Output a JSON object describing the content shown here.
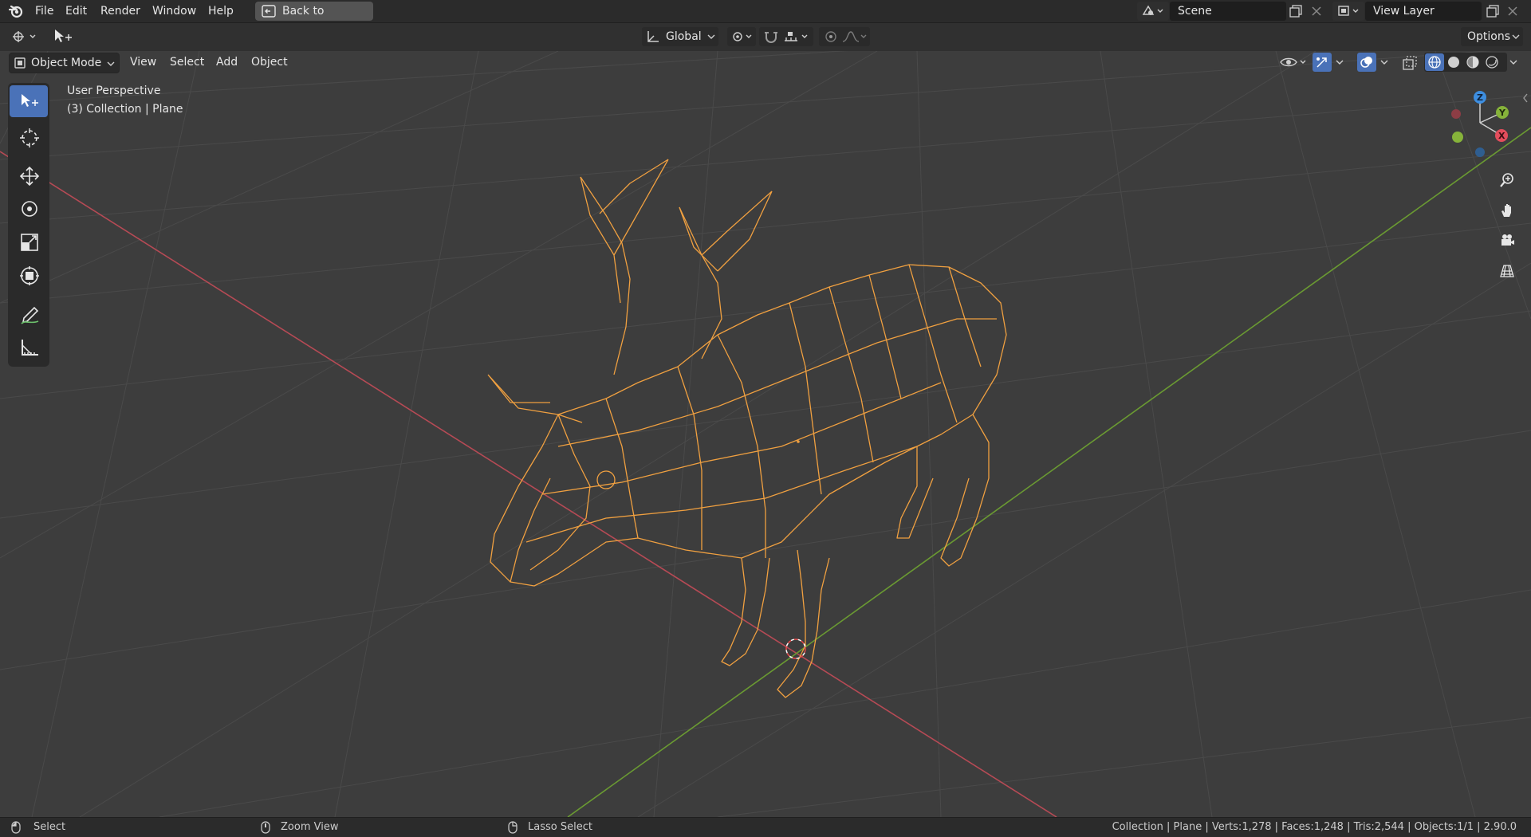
{
  "menubar": {
    "items": [
      "File",
      "Edit",
      "Render",
      "Window",
      "Help"
    ],
    "back_label": "Back to Previous",
    "scene_name": "Scene",
    "view_layer_name": "View Layer"
  },
  "header": {
    "transform_orientation": "Global",
    "options_label": "Options"
  },
  "viewport_header": {
    "mode": "Object Mode",
    "menus": [
      "View",
      "Select",
      "Add",
      "Object"
    ]
  },
  "overlay": {
    "view_name": "User Perspective",
    "context": "(3) Collection | Plane"
  },
  "gizmo": {
    "axes": [
      "Z",
      "Y",
      "X"
    ],
    "colors": {
      "x": "#e34d5c",
      "y": "#86b33a",
      "z": "#3d8ee0"
    }
  },
  "statusbar": {
    "select": "Select",
    "zoom": "Zoom View",
    "lasso": "Lasso Select",
    "stats": "Collection | Plane | Verts:1,278 | Faces:1,248 | Tris:2,544 | Objects:1/1 | 2.90.0"
  },
  "colors": {
    "wire": "#f0a040",
    "accent": "#4a72b8",
    "x_axis_line": "#b64a55",
    "y_axis_line": "#6a9a32"
  }
}
